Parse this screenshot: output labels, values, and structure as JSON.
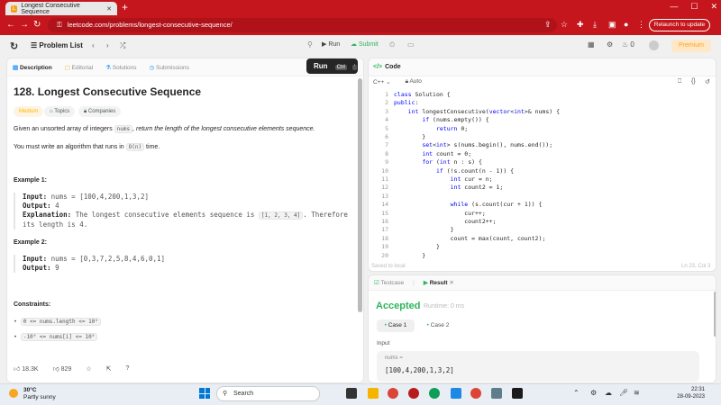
{
  "browser": {
    "tab_title": "Longest Consecutive Sequence",
    "url": "leetcode.com/problems/longest-consecutive-sequence/",
    "relaunch_label": "Relaunch to update"
  },
  "header": {
    "problem_list_label": "Problem List",
    "run_label": "Run",
    "submit_label": "Submit",
    "coin_count": "0",
    "premium_label": "Premium"
  },
  "left_tabs": [
    "Description",
    "Editorial",
    "Solutions",
    "Submissions"
  ],
  "problem": {
    "title": "128. Longest Consecutive Sequence",
    "difficulty": "Medium",
    "topics_label": "Topics",
    "companies_label": "Companies",
    "desc_p1_a": "Given an unsorted array of integers ",
    "desc_p1_code": "nums",
    "desc_p1_b": ", return the length of the longest consecutive elements sequence.",
    "desc_p2_a": "You must write an algorithm that runs in ",
    "desc_p2_code": "O(n)",
    "desc_p2_b": " time.",
    "example1_title": "Example 1:",
    "example1_input_label": "Input:",
    "example1_input": "nums = [100,4,200,1,3,2]",
    "example1_output_label": "Output:",
    "example1_output": "4",
    "example1_expl_label": "Explanation:",
    "example1_expl_a": "The longest consecutive elements sequence is ",
    "example1_expl_code": "[1, 2, 3, 4]",
    "example1_expl_b": ". Therefore",
    "example1_expl_c": "its length is 4.",
    "example2_title": "Example 2:",
    "example2_input_label": "Input:",
    "example2_input": "nums = [0,3,7,2,5,8,4,6,0,1]",
    "example2_output_label": "Output:",
    "example2_output": "9",
    "constraints_title": "Constraints:",
    "constraint1": "0 <= nums.length <= 10⁵",
    "constraint2": "-10⁹ <= nums[i] <= 10⁹",
    "likes": "18.3K",
    "dislikes": "829"
  },
  "run_popup": {
    "label": "Run",
    "shortcut": "Ctrl",
    "key": "'"
  },
  "code_panel": {
    "tab_label": "Code",
    "language": "C++",
    "mode": "Auto",
    "saved_text": "Saved to local",
    "position_text": "Ln 23, Col 3",
    "lines": [
      "class Solution {",
      "public:",
      "    int longestConsecutive(vector<int>& nums) {",
      "        if (nums.empty()) {",
      "            return 0;",
      "        }",
      "        set<int> s(nums.begin(), nums.end());",
      "        int count = 0;",
      "        for (int n : s) {",
      "            if (!s.count(n - 1)) {",
      "                int cur = n;",
      "                int count2 = 1;",
      "",
      "                while (s.count(cur + 1)) {",
      "                    cur++;",
      "                    count2++;",
      "                }",
      "                count = max(count, count2);",
      "            }",
      "        }"
    ]
  },
  "result_panel": {
    "testcase_label": "Testcase",
    "result_label": "Result",
    "status": "Accepted",
    "runtime": "Runtime: 0 ms",
    "case1": "Case 1",
    "case2": "Case 2",
    "input_label": "Input",
    "var_name": "nums =",
    "var_value": "[100,4,200,1,3,2]"
  },
  "taskbar": {
    "temperature": "30°C",
    "weather": "Partly sunny",
    "search_placeholder": "Search",
    "time": "22:31",
    "date": "28-09-2023"
  }
}
